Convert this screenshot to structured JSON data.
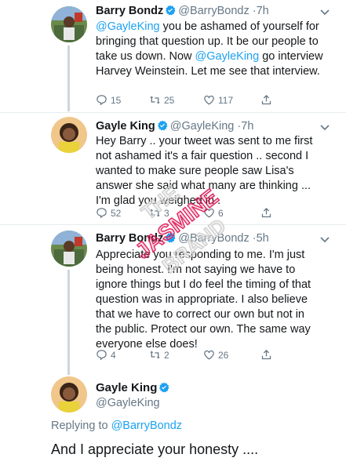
{
  "tweets": [
    {
      "name": "Barry Bondz",
      "handle": "@BarryBondz",
      "sep": "·",
      "time": "7h",
      "text_parts": [
        {
          "t": "@GayleKing",
          "mention": true
        },
        {
          "t": " you be ashamed of yourself for bringing that question up. It be our people to take us down. Now ",
          "mention": false
        },
        {
          "t": "@GayleKing",
          "mention": true
        },
        {
          "t": " go interview Harvey Weinstein. Let me see that interview.",
          "mention": false
        }
      ],
      "replies": "15",
      "retweets": "25",
      "likes": "117"
    },
    {
      "name": "Gayle King",
      "handle": "@GayleKing",
      "sep": "·",
      "time": "7h",
      "text_parts": [
        {
          "t": "Hey Barry .. your tweet was sent to me first not ashamed it's a fair question .. second I wanted to make sure people saw Lisa's answer she said what many are thinking ... I'm glad you weighed in .",
          "mention": false
        }
      ],
      "replies": "52",
      "retweets": "3",
      "likes": "6"
    },
    {
      "name": "Barry Bondz",
      "handle": "@BarryBondz",
      "sep": "·",
      "time": "5h",
      "text_parts": [
        {
          "t": "Appreciate you responding to me. I'm just being honest. I'm not saying we have to ignore things but I do feel the timing of that question was in appropriate. I also believe that we have to correct our own but not in the public. Protect our own. The same way everyone else does!",
          "mention": false
        }
      ],
      "replies": "4",
      "retweets": "2",
      "likes": "26"
    }
  ],
  "detail": {
    "name": "Gayle King",
    "handle": "@GayleKing",
    "replying_prefix": "Replying to ",
    "replying_to": "@BarryBondz",
    "text": "And I appreciate your honesty ...."
  },
  "colors": {
    "link": "#1da1f2",
    "secondary": "#657786",
    "watermark": "#e0245e"
  },
  "watermark_text": [
    "THE",
    "JASMINE",
    "BRAND"
  ]
}
